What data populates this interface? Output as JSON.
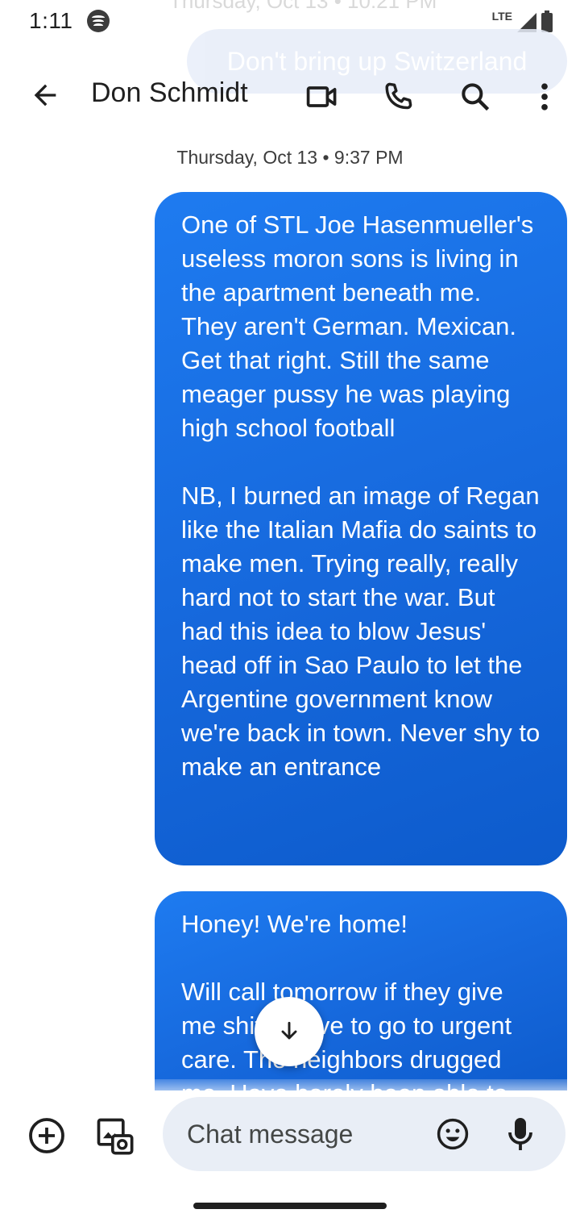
{
  "status_bar": {
    "time": "1:11",
    "network": "LTE"
  },
  "overlay": {
    "faded_top_text": "Thursday, Oct 13 • 10:21 PM",
    "faded_bubble_text": "Don't bring up Switzerland"
  },
  "header": {
    "contact_name": "Don Schmidt"
  },
  "conversation": {
    "date_separator": "Thursday, Oct 13 • 9:37 PM",
    "messages": [
      {
        "text": "One of STL Joe Hasenmueller's useless moron sons is living in the apartment beneath me. They aren't German. Mexican.\nGet that right. Still the same meager pussy he was playing high school football\n\nNB, I burned an image of Regan like the Italian Mafia do saints to make men. Trying really, really hard not to start the war. But had this idea to blow Jesus' head off in Sao Paulo to let the Argentine government know we're back in town. Never shy to make an entrance"
      },
      {
        "text": "Honey! We're home!\n\nWill call tomorrow if they give me shit. I have to go to urgent care. The neighbors drugged me. Have barely been able to"
      }
    ]
  },
  "compose": {
    "placeholder": "Chat message"
  },
  "icons": {
    "back": "arrow-back-icon",
    "video": "video-call-icon",
    "call": "phone-icon",
    "search": "search-icon",
    "more": "more-vert-icon",
    "scroll": "arrow-down-icon",
    "add": "add-circle-icon",
    "gallery": "gallery-icon",
    "emoji": "emoji-icon",
    "mic": "mic-icon"
  },
  "colors": {
    "bubble": "#1a73e8",
    "compose_bg": "#e9eef6"
  }
}
